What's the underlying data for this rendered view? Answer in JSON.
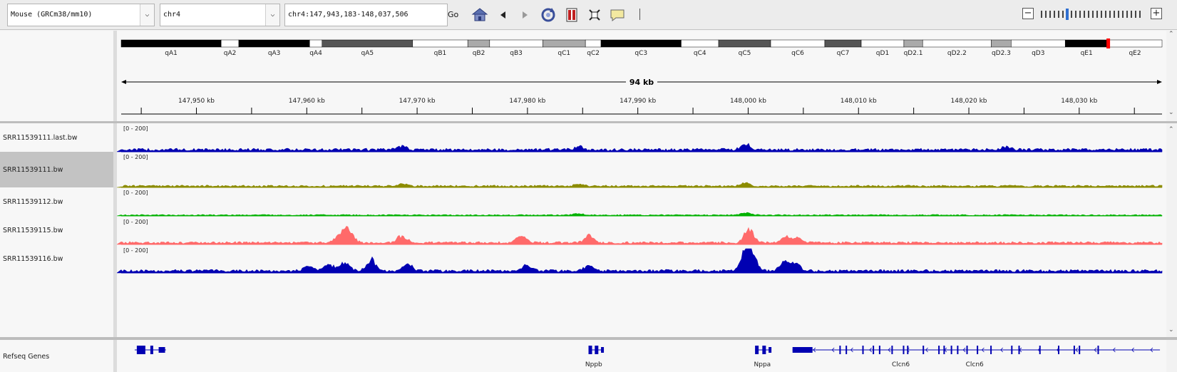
{
  "toolbar": {
    "genome": "Mouse (GRCm38/mm10)",
    "chromosome": "chr4",
    "locus": "chr4:147,943,183-148,037,506",
    "go_label": "Go",
    "dropdown_glyph": "⌵",
    "icons": [
      "home-icon",
      "back-icon",
      "forward-icon",
      "refresh-icon",
      "region-icon",
      "fit-window-icon",
      "popup-info-icon"
    ],
    "zoom_minus": "−",
    "zoom_plus": "+",
    "zoom_level": 6,
    "zoom_ticks": 24
  },
  "ideogram": {
    "bands": [
      {
        "label": "qA1",
        "start": 0.0,
        "end": 0.096,
        "fill": "#000000"
      },
      {
        "label": "qA2",
        "start": 0.096,
        "end": 0.113,
        "fill": "#ffffff"
      },
      {
        "label": "qA3",
        "start": 0.113,
        "end": 0.181,
        "fill": "#000000"
      },
      {
        "label": "qA4",
        "start": 0.181,
        "end": 0.193,
        "fill": "#ffffff"
      },
      {
        "label": "qA5",
        "start": 0.193,
        "end": 0.28,
        "fill": "#555555"
      },
      {
        "label": "qB1",
        "start": 0.28,
        "end": 0.333,
        "fill": "#ffffff"
      },
      {
        "label": "qB2",
        "start": 0.333,
        "end": 0.354,
        "fill": "#aaaaaa"
      },
      {
        "label": "qB3",
        "start": 0.354,
        "end": 0.405,
        "fill": "#ffffff"
      },
      {
        "label": "qC1",
        "start": 0.405,
        "end": 0.446,
        "fill": "#aaaaaa"
      },
      {
        "label": "qC2",
        "start": 0.446,
        "end": 0.461,
        "fill": "#ffffff"
      },
      {
        "label": "qC3",
        "start": 0.461,
        "end": 0.538,
        "fill": "#000000"
      },
      {
        "label": "qC4",
        "start": 0.538,
        "end": 0.574,
        "fill": "#ffffff"
      },
      {
        "label": "qC5",
        "start": 0.574,
        "end": 0.624,
        "fill": "#555555"
      },
      {
        "label": "qC6",
        "start": 0.624,
        "end": 0.676,
        "fill": "#ffffff"
      },
      {
        "label": "qC7",
        "start": 0.676,
        "end": 0.711,
        "fill": "#555555"
      },
      {
        "label": "qD1",
        "start": 0.711,
        "end": 0.752,
        "fill": "#ffffff"
      },
      {
        "label": "qD2.1",
        "start": 0.752,
        "end": 0.77,
        "fill": "#aaaaaa"
      },
      {
        "label": "qD2.2",
        "start": 0.77,
        "end": 0.836,
        "fill": "#ffffff"
      },
      {
        "label": "qD2.3",
        "start": 0.836,
        "end": 0.855,
        "fill": "#aaaaaa"
      },
      {
        "label": "qD3",
        "start": 0.855,
        "end": 0.907,
        "fill": "#ffffff"
      },
      {
        "label": "qE1",
        "start": 0.907,
        "end": 0.948,
        "fill": "#000000"
      },
      {
        "label": "qE2",
        "start": 0.948,
        "end": 1.0,
        "fill": "#ffffff"
      }
    ],
    "current_position": 0.948,
    "marker_color": "#ff0000"
  },
  "ruler": {
    "span_label": "94 kb",
    "range_start_kb": 147943.183,
    "range_end_kb": 148037.506,
    "ticks": [
      "147,950 kb",
      "147,960 kb",
      "147,970 kb",
      "147,980 kb",
      "147,990 kb",
      "148,000 kb",
      "148,010 kb",
      "148,020 kb",
      "148,030 kb"
    ],
    "tick_kb": [
      147950,
      147960,
      147970,
      147980,
      147990,
      148000,
      148010,
      148020,
      148030
    ]
  },
  "tracks": [
    {
      "name": "SRR11539111.last.bw",
      "range": "[0 - 200]",
      "color": "#0000b2",
      "selected": false,
      "peaks": [
        [
          0.27,
          0.15
        ],
        [
          0.44,
          0.12
        ],
        [
          0.6,
          0.25
        ],
        [
          0.85,
          0.12
        ]
      ],
      "baseline": 0.12
    },
    {
      "name": "SRR11539111.bw",
      "range": "[0 - 200]",
      "color": "#8c8c00",
      "selected": true,
      "peaks": [
        [
          0.27,
          0.08
        ],
        [
          0.44,
          0.08
        ],
        [
          0.6,
          0.12
        ]
      ],
      "baseline": 0.08
    },
    {
      "name": "SRR11539112.bw",
      "range": "[0 - 200]",
      "color": "#00b200",
      "selected": false,
      "peaks": [
        [
          0.6,
          0.12
        ],
        [
          0.44,
          0.06
        ]
      ],
      "baseline": 0.05
    },
    {
      "name": "SRR11539115.bw",
      "range": "[0 - 200]",
      "color": "#ff6a6a",
      "selected": false,
      "peaks": [
        [
          0.21,
          0.25
        ],
        [
          0.215,
          0.3
        ],
        [
          0.22,
          0.35
        ],
        [
          0.27,
          0.3
        ],
        [
          0.385,
          0.3
        ],
        [
          0.45,
          0.3
        ],
        [
          0.603,
          0.6
        ],
        [
          0.639,
          0.28
        ],
        [
          0.65,
          0.22
        ]
      ],
      "baseline": 0.1
    },
    {
      "name": "SRR11539116.bw",
      "range": "[0 - 200]",
      "color": "#0000b2",
      "selected": false,
      "peaks": [
        [
          0.18,
          0.2
        ],
        [
          0.2,
          0.3
        ],
        [
          0.215,
          0.4
        ],
        [
          0.24,
          0.45
        ],
        [
          0.275,
          0.3
        ],
        [
          0.39,
          0.25
        ],
        [
          0.45,
          0.25
        ],
        [
          0.6,
          1.0
        ],
        [
          0.607,
          0.6
        ],
        [
          0.638,
          0.4
        ],
        [
          0.648,
          0.3
        ]
      ],
      "baseline": 0.12
    }
  ],
  "genes": {
    "track_name": "Refseq Genes",
    "labels": [
      {
        "name": "Nppb",
        "pos": 0.454
      },
      {
        "name": "Nppa",
        "pos": 0.616
      },
      {
        "name": "Clcn6",
        "pos": 0.749
      },
      {
        "name": "Clcn6",
        "pos": 0.82
      }
    ],
    "color": "#0000b2"
  }
}
